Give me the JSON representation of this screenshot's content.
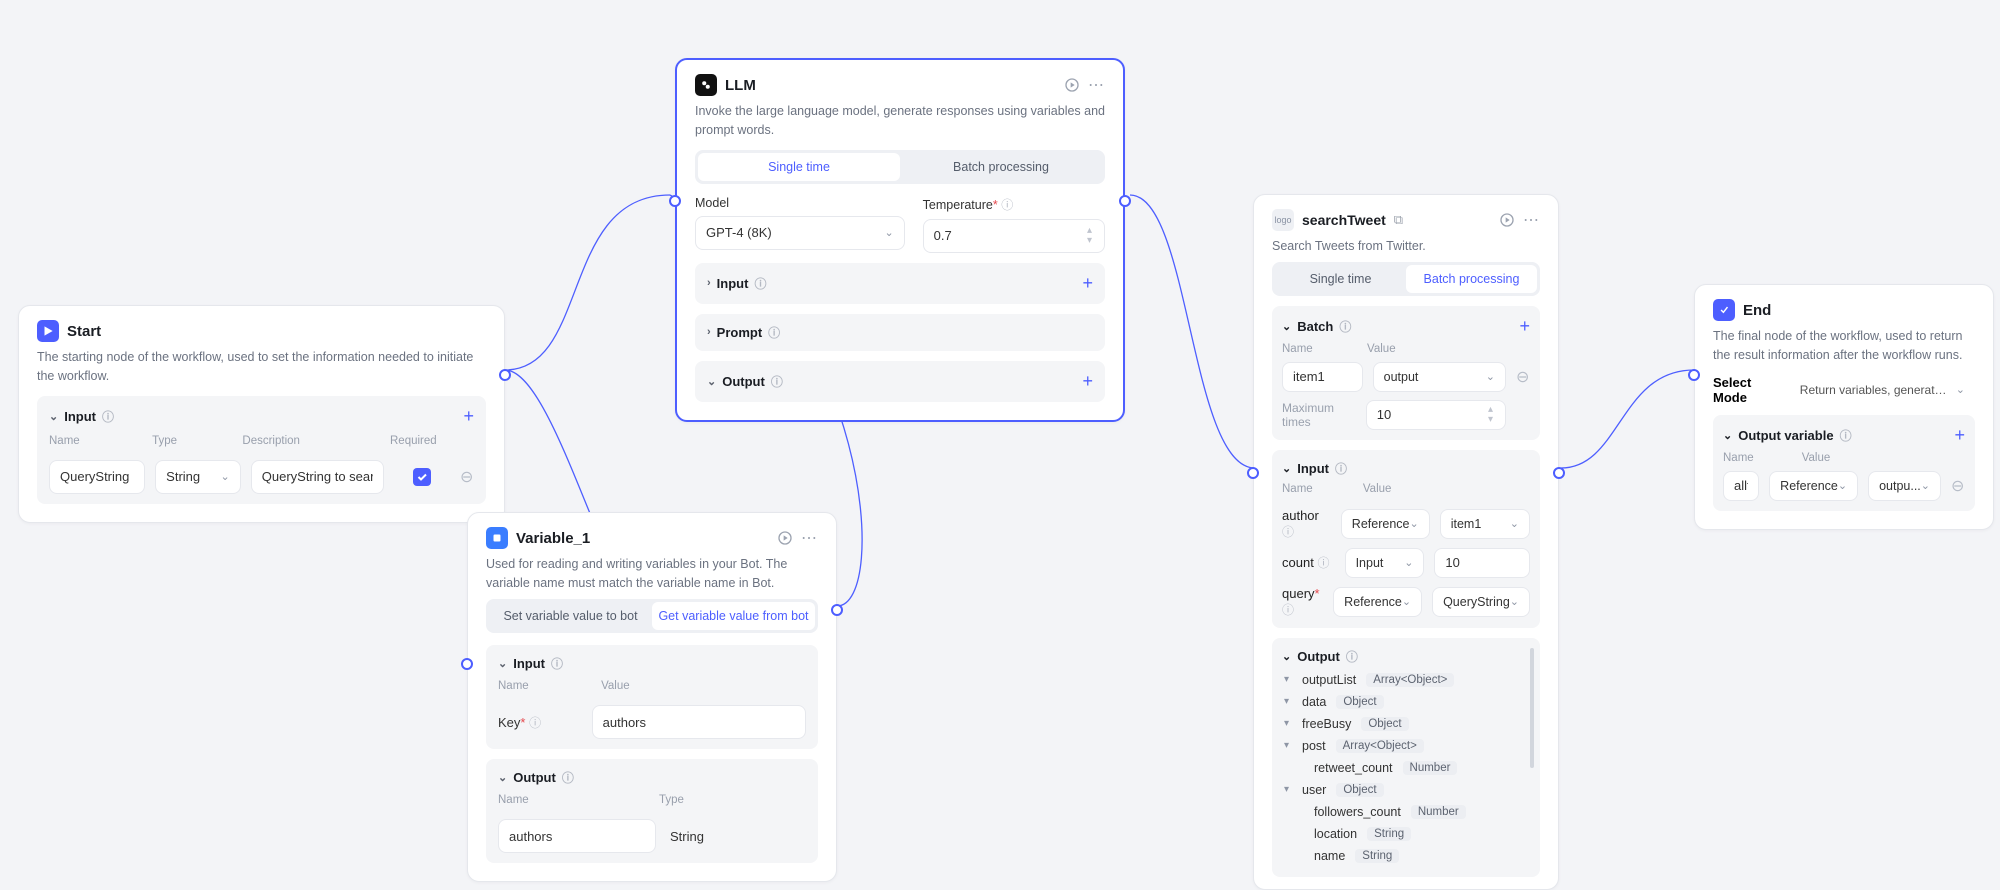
{
  "colors": {
    "accent": "#4d5eff",
    "danger": "#e5484d"
  },
  "start": {
    "title": "Start",
    "desc": "The starting node of the workflow, used to set the information needed to initiate the workflow.",
    "section": "Input",
    "cols": {
      "name": "Name",
      "type": "Type",
      "description": "Description",
      "required": "Required"
    },
    "row": {
      "name": "QueryString",
      "type": "String",
      "desc": "QueryString to search"
    }
  },
  "llm": {
    "title": "LLM",
    "desc": "Invoke the large language model, generate responses using variables and prompt words.",
    "tabs": {
      "single": "Single time",
      "batch": "Batch processing"
    },
    "model_label": "Model",
    "temp_label": "Temperature",
    "model": "GPT-4 (8K)",
    "temp": "0.7",
    "sec_input": "Input",
    "sec_prompt": "Prompt",
    "sec_output": "Output"
  },
  "var": {
    "title": "Variable_1",
    "desc": "Used for reading and writing variables in your Bot. The variable name must match the variable name in Bot.",
    "tabs": {
      "set": "Set variable value to bot",
      "get": "Get variable value from bot"
    },
    "sec_input": "Input",
    "name_label": "Name",
    "value_label": "Value",
    "key_label": "Key",
    "key_value": "authors",
    "sec_output": "Output",
    "out_name_label": "Name",
    "out_type_label": "Type",
    "out_name": "authors",
    "out_type": "String"
  },
  "search": {
    "title": "searchTweet",
    "desc": "Search Tweets from Twitter.",
    "tabs": {
      "single": "Single time",
      "batch": "Batch processing"
    },
    "sec_batch": "Batch",
    "name_label": "Name",
    "value_label": "Value",
    "batch_name": "item1",
    "batch_value": "output",
    "max_label": "Maximum times",
    "max_value": "10",
    "sec_input": "Input",
    "inputs": [
      {
        "key": "author",
        "type": "Reference",
        "val": "item1"
      },
      {
        "key": "count",
        "type": "Input",
        "val": "10"
      },
      {
        "key": "query",
        "req": true,
        "type": "Reference",
        "val": "QueryString"
      }
    ],
    "sec_output": "Output",
    "tree": [
      {
        "k": "outputList",
        "t": "Array<Object>",
        "d": 0
      },
      {
        "k": "data",
        "t": "Object",
        "d": 0
      },
      {
        "k": "freeBusy",
        "t": "Object",
        "d": 0
      },
      {
        "k": "post",
        "t": "Array<Object>",
        "d": 0
      },
      {
        "k": "retweet_count",
        "t": "Number",
        "d": 1,
        "leaf": true
      },
      {
        "k": "user",
        "t": "Object",
        "d": 0
      },
      {
        "k": "followers_count",
        "t": "Number",
        "d": 1,
        "leaf": true
      },
      {
        "k": "location",
        "t": "String",
        "d": 1,
        "leaf": true
      },
      {
        "k": "name",
        "t": "String",
        "d": 1,
        "leaf": true
      }
    ]
  },
  "end": {
    "title": "End",
    "desc": "The final node of the workflow, used to return the result information after the workflow runs.",
    "mode_label": "Select Mode",
    "mode_value": "Return variables, generated by the ...",
    "sec_out": "Output variable",
    "name_label": "Name",
    "value_label": "Value",
    "out_name": "alltweets",
    "out_type": "Reference",
    "out_val": "outpu..."
  }
}
